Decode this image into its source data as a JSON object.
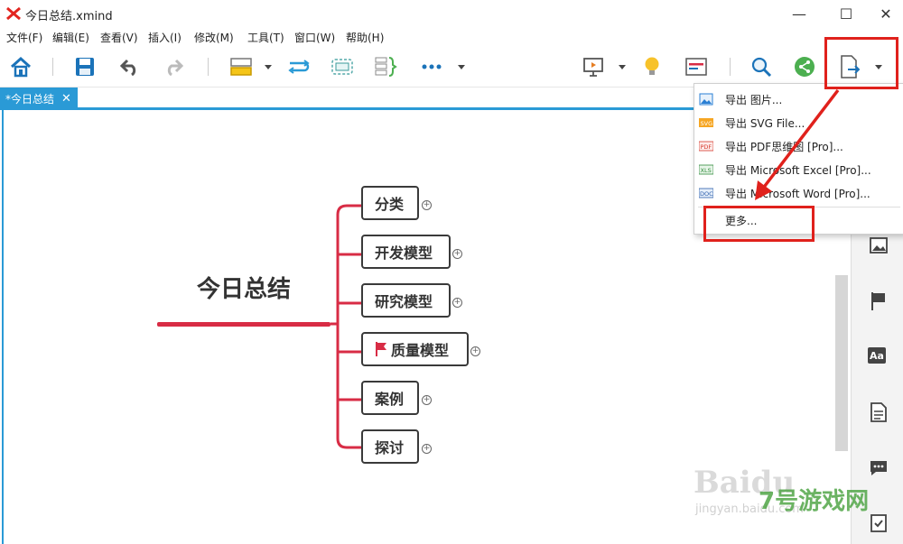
{
  "window": {
    "title": "今日总结.xmind",
    "minimize_glyph": "—",
    "maximize_glyph": "☐",
    "close_glyph": "✕"
  },
  "menu": [
    "文件(F)",
    "编辑(E)",
    "查看(V)",
    "插入(I)",
    "修改(M)",
    "工具(T)",
    "窗口(W)",
    "帮助(H)"
  ],
  "toolbar": {
    "icons": [
      "home-icon",
      "save-icon",
      "undo-icon",
      "redo-icon",
      "topic-icon",
      "relationship-icon",
      "boundary-icon",
      "summary-icon",
      "more-icon",
      "presentation-icon",
      "idea-icon",
      "outline-icon",
      "search-icon",
      "share-icon",
      "export-icon"
    ]
  },
  "tabs": [
    {
      "label": "*今日总结",
      "close": "✕"
    }
  ],
  "mindmap": {
    "central": "今日总结",
    "topics": [
      "分类",
      "开发模型",
      "研究模型",
      "质量模型",
      "案例",
      "探讨"
    ],
    "flag_topic_index": 3,
    "branch_color": "#d82c45"
  },
  "export_menu": {
    "items": [
      {
        "label": "导出 图片...",
        "icon": "image-file-icon"
      },
      {
        "label": "导出 SVG File...",
        "icon": "svg-file-icon"
      },
      {
        "label": "导出 PDF思维图 [Pro]...",
        "icon": "pdf-file-icon"
      },
      {
        "label": "导出 Microsoft Excel [Pro]...",
        "icon": "excel-file-icon"
      },
      {
        "label": "导出 Microsoft Word [Pro]...",
        "icon": "word-file-icon"
      },
      {
        "label": "更多...",
        "icon": ""
      }
    ]
  },
  "right_panel": {
    "icons": [
      "image-icon",
      "flag-icon",
      "text-style-icon",
      "notes-icon",
      "comment-icon",
      "task-icon"
    ],
    "text_icon_label": "Aa"
  },
  "colors": {
    "accent": "#2a9ad6",
    "highlight": "#e0211c",
    "branch": "#d82c45"
  },
  "watermark": {
    "baidu": "Baidu",
    "jingyan": "jingyan.baidu.com",
    "site": "7号游戏网"
  }
}
